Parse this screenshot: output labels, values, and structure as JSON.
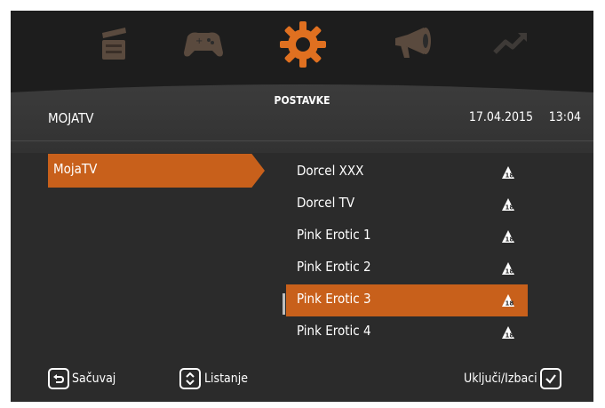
{
  "colors": {
    "accent": "#c8601b",
    "background": "#2b2b2b"
  },
  "top_menu": {
    "items": [
      {
        "icon": "clapperboard-icon",
        "active": false
      },
      {
        "icon": "gamepad-icon",
        "active": false
      },
      {
        "icon": "gear-icon",
        "active": true
      },
      {
        "icon": "megaphone-icon",
        "active": false
      },
      {
        "icon": "trend-icon",
        "active": false
      }
    ],
    "active_label": "POSTAVKE"
  },
  "header": {
    "title": "MOJATV",
    "date": "17.04.2015",
    "time": "13:04"
  },
  "left_menu": {
    "selected": "MojaTV"
  },
  "channels": [
    {
      "name": "Dorcel XXX",
      "icon": "parental-lock-icon"
    },
    {
      "name": "Dorcel TV",
      "icon": "parental-lock-icon"
    },
    {
      "name": "Pink Erotic 1",
      "icon": "parental-lock-icon"
    },
    {
      "name": "Pink Erotic 2",
      "icon": "parental-lock-icon"
    },
    {
      "name": "Pink Erotic 3",
      "icon": "parental-lock-icon",
      "selected": true
    },
    {
      "name": "Pink Erotic 4",
      "icon": "parental-lock-icon"
    }
  ],
  "footer": {
    "save_label": "Sačuvaj",
    "scroll_label": "Listanje",
    "toggle_label": "Uključi/Izbaci"
  }
}
